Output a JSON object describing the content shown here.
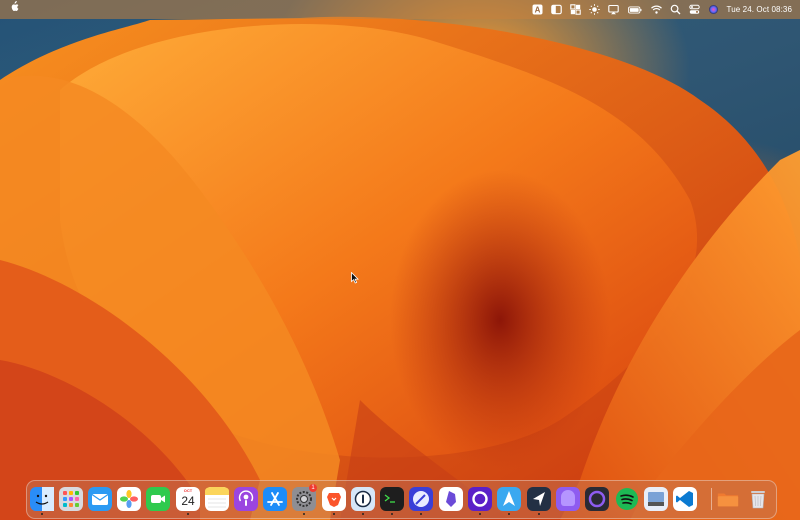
{
  "menubar": {
    "apple": "apple-logo-icon",
    "status_icons": [
      "accessibility-keyboard-icon",
      "sidebar-icon",
      "window-layout-icon",
      "brightness-icon",
      "display-mirroring-icon",
      "battery-icon",
      "wifi-icon",
      "search-icon",
      "control-center-icon",
      "siri-icon"
    ],
    "battery_text": "",
    "clock": "Tue 24. Oct  08:36"
  },
  "dock": {
    "apps": [
      {
        "name": "Finder",
        "icon": "finder-icon",
        "color": "#2a8df7",
        "running": true
      },
      {
        "name": "Launchpad",
        "icon": "launchpad-icon",
        "color": "#d9d9de",
        "running": false
      },
      {
        "name": "Mail",
        "icon": "mail-icon",
        "color": "#2b9af3",
        "running": false
      },
      {
        "name": "Photos",
        "icon": "photos-icon",
        "color": "#ffffff",
        "running": false
      },
      {
        "name": "FaceTime",
        "icon": "facetime-icon",
        "color": "#2fca4e",
        "running": false
      },
      {
        "name": "Calendar",
        "icon": "calendar-icon",
        "color": "#ffffff",
        "running": true,
        "month": "OCT",
        "day": "24"
      },
      {
        "name": "Notes",
        "icon": "notes-icon",
        "color": "#fbd55b",
        "running": false
      },
      {
        "name": "Podcasts",
        "icon": "podcasts-icon",
        "color": "#9b45e0",
        "running": false
      },
      {
        "name": "App Store",
        "icon": "app-store-icon",
        "color": "#1d8cf8",
        "running": false
      },
      {
        "name": "System Settings",
        "icon": "system-settings-icon",
        "color": "#8e8e93",
        "running": true,
        "badge": "1"
      },
      {
        "name": "Brave",
        "icon": "brave-icon",
        "color": "#ffffff",
        "running": true
      },
      {
        "name": "1Password",
        "icon": "onepassword-icon",
        "color": "#d6e6f8",
        "running": true
      },
      {
        "name": "Terminal",
        "icon": "terminal-icon",
        "color": "#1e1e1e",
        "running": true
      },
      {
        "name": "Safari",
        "icon": "safari-icon",
        "color": "#3a3fd8",
        "running": true
      },
      {
        "name": "Obsidian",
        "icon": "obsidian-icon",
        "color": "#ffffff",
        "running": false
      },
      {
        "name": "Arc",
        "icon": "arc-icon",
        "color": "#5a20c8",
        "running": true
      },
      {
        "name": "Testflight",
        "icon": "testflight-icon",
        "color": "#3aa8f0",
        "running": true
      },
      {
        "name": "Linear",
        "icon": "linear-icon",
        "color": "#233044",
        "running": true
      },
      {
        "name": "Raycast",
        "icon": "raycast-icon",
        "color": "#8e5cf0",
        "running": false
      },
      {
        "name": "Screen Recorder",
        "icon": "recorder-icon",
        "color": "#2a2a34",
        "running": false
      },
      {
        "name": "Spotify",
        "icon": "spotify-icon",
        "color": "#1d1d1d",
        "running": false
      },
      {
        "name": "Preview",
        "icon": "preview-icon",
        "color": "#e8eef8",
        "running": false
      },
      {
        "name": "VS Code",
        "icon": "vscode-icon",
        "color": "#ffffff",
        "running": false
      },
      {
        "name": "Downloads",
        "icon": "downloads-folder-icon",
        "color": "#f07a30",
        "running": false
      },
      {
        "name": "Trash",
        "icon": "trash-icon",
        "color": "#e5e5ea",
        "running": false
      }
    ]
  }
}
